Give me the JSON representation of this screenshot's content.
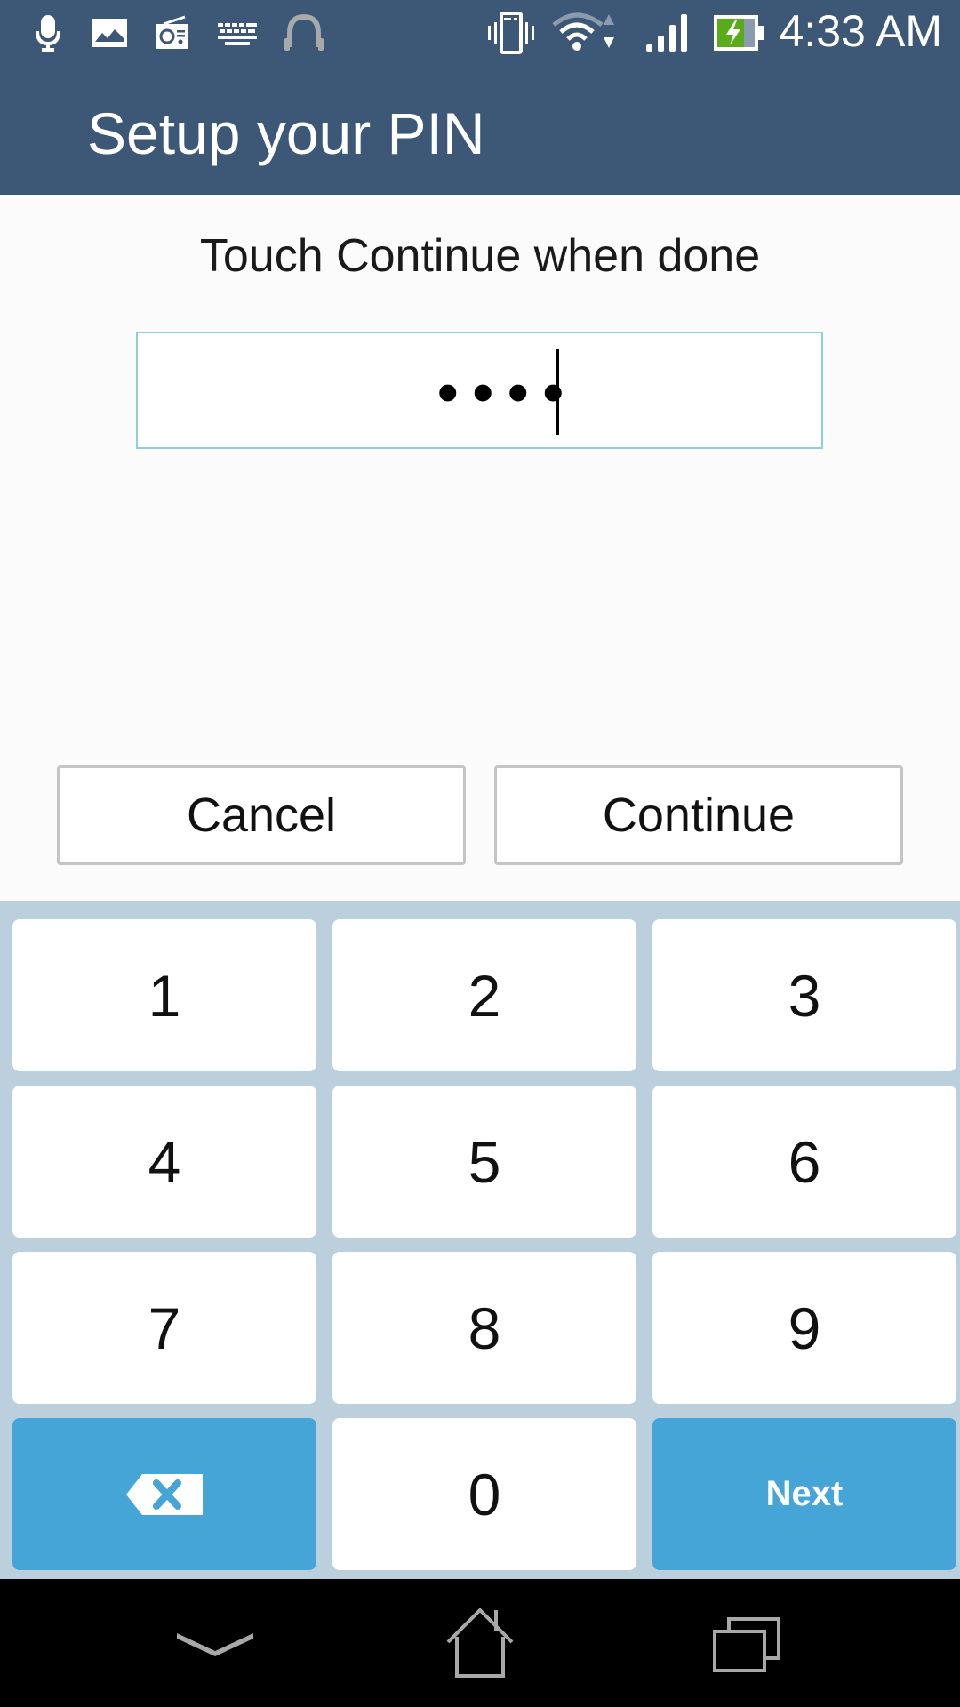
{
  "status_bar": {
    "time": "4:33 AM",
    "left_icons": [
      "microphone-icon",
      "image-icon",
      "radio-icon",
      "keyboard-icon",
      "headphones-icon"
    ],
    "right_icons": [
      "vibrate-icon",
      "wifi-icon",
      "signal-icon",
      "battery-charging-icon"
    ],
    "battery_color": "#5aaa1a"
  },
  "app_bar": {
    "title": "Setup your PIN",
    "background": "#3d5876"
  },
  "content": {
    "instruction": "Touch Continue when done",
    "pin_field": {
      "masked_value": "••••",
      "digit_count": 4,
      "border_color": "#8ccfde"
    },
    "cancel_label": "Cancel",
    "continue_label": "Continue"
  },
  "keypad": {
    "keys": [
      "1",
      "2",
      "3",
      "4",
      "5",
      "6",
      "7",
      "8",
      "9"
    ],
    "zero": "0",
    "backspace_icon": "backspace-icon",
    "next_label": "Next",
    "accent": "#45a5d6",
    "background": "#bccfdc"
  },
  "nav_bar": {
    "buttons": [
      "back-icon",
      "home-icon",
      "recent-apps-icon"
    ]
  }
}
